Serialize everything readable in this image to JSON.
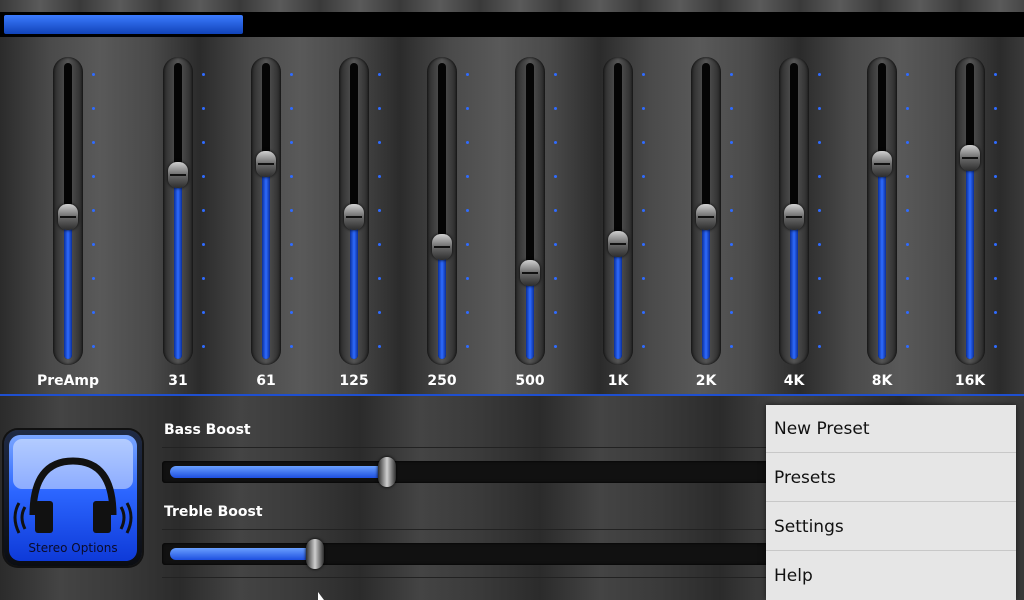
{
  "progress": {
    "value": 0.235
  },
  "equalizer": {
    "bands": [
      {
        "label": "PreAmp",
        "level": 0.48
      },
      {
        "label": "31",
        "level": 0.62
      },
      {
        "label": "61",
        "level": 0.66
      },
      {
        "label": "125",
        "level": 0.48
      },
      {
        "label": "250",
        "level": 0.38
      },
      {
        "label": "500",
        "level": 0.29
      },
      {
        "label": "1K",
        "level": 0.39
      },
      {
        "label": "2K",
        "level": 0.48
      },
      {
        "label": "4K",
        "level": 0.48
      },
      {
        "label": "8K",
        "level": 0.66
      },
      {
        "label": "16K",
        "level": 0.68
      }
    ]
  },
  "stereo": {
    "label": "Stereo Options"
  },
  "bass": {
    "label": "Bass Boost",
    "level": 0.36
  },
  "treble": {
    "label": "Treble Boost",
    "level": 0.24
  },
  "menu": {
    "items": [
      "New Preset",
      "Presets",
      "Settings",
      "Help"
    ]
  },
  "colors": {
    "accent": "#1f5cff",
    "menu_bg": "#e6e6e6"
  }
}
